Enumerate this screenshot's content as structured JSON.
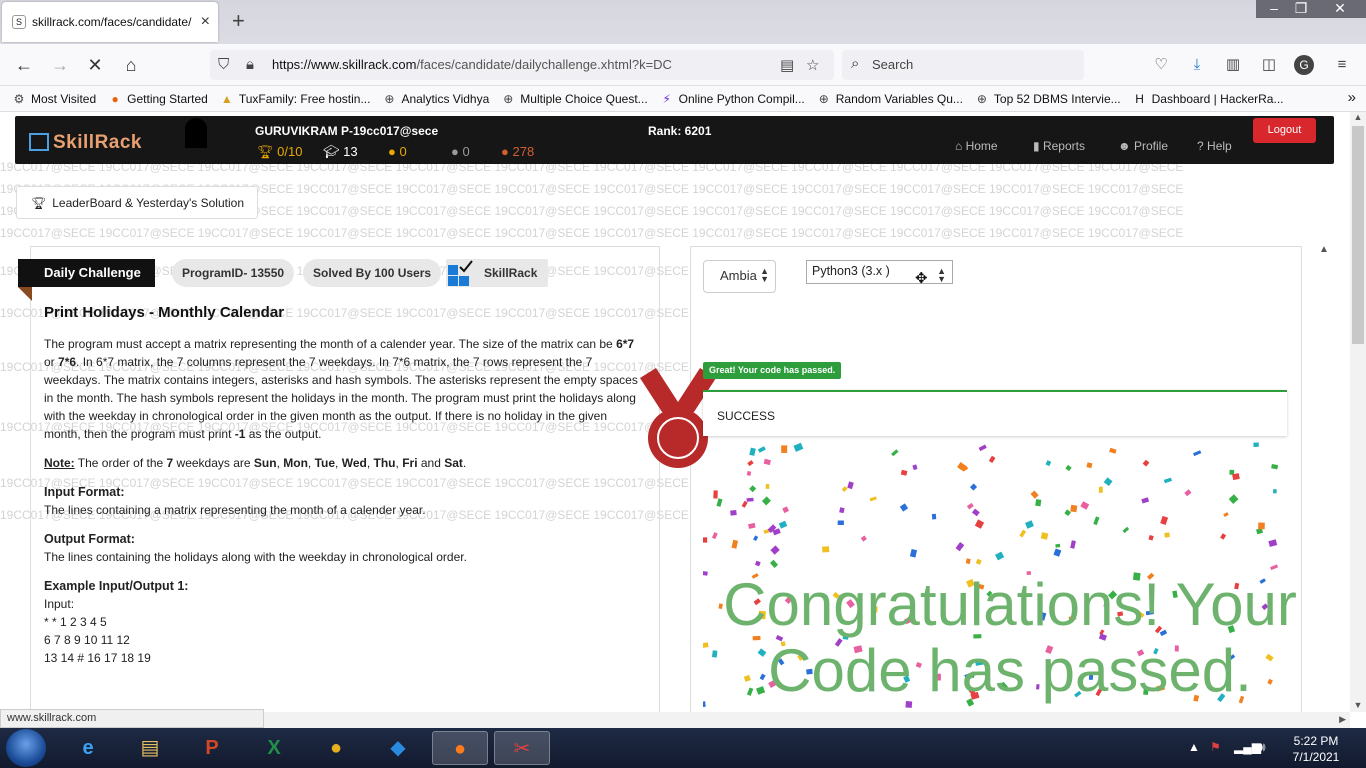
{
  "browser": {
    "tab_title": "skillrack.com/faces/candidate/",
    "url_host": "https://www.skillrack.com",
    "url_path": "/faces/candidate/dailychallenge.xhtml?k=DC",
    "search_placeholder": "Search",
    "bookmarks": [
      {
        "label": "Most Visited",
        "icon": "gear-icon",
        "color": "#444444"
      },
      {
        "label": "Getting Started",
        "icon": "firefox-icon",
        "color": "#e8640c"
      },
      {
        "label": "TuxFamily: Free hostin...",
        "icon": "tux-icon",
        "color": "#d8a020"
      },
      {
        "label": "Analytics Vidhya",
        "icon": "globe-icon",
        "color": "#444444"
      },
      {
        "label": "Multiple Choice Quest...",
        "icon": "globe-icon",
        "color": "#444444"
      },
      {
        "label": "Online Python Compil...",
        "icon": "bolt-icon",
        "color": "#6a2ad8"
      },
      {
        "label": "Random Variables Qu...",
        "icon": "globe-icon",
        "color": "#444444"
      },
      {
        "label": "Top 52 DBMS Intervie...",
        "icon": "globe-icon",
        "color": "#444444"
      },
      {
        "label": "Dashboard | HackerRa...",
        "icon": "hackerrank-icon",
        "color": "#111111"
      }
    ],
    "status_url": "www.skillrack.com"
  },
  "site": {
    "logo": "SkillRack",
    "user": "GURUVIKRAM P-19cc017@sece",
    "rank": "Rank: 6201",
    "stats": [
      {
        "value": "0/10",
        "icon": "trophy-icon",
        "color": "#e8a800"
      },
      {
        "value": "13",
        "icon": "graduation-cap-icon",
        "color": "#ffffff"
      },
      {
        "value": "0",
        "icon": "gold-medal-icon",
        "color": "#e8a800"
      },
      {
        "value": "0",
        "icon": "silver-medal-icon",
        "color": "#9a9a9a"
      },
      {
        "value": "278",
        "icon": "bronze-medal-icon",
        "color": "#d06030"
      }
    ],
    "nav": [
      "Home",
      "Reports",
      "Profile",
      "Help"
    ],
    "logout": "Logout",
    "watermark": "19CC017@SECE 19CC017@SECE 19CC017@SECE 19CC017@SECE 19CC017@SECE 19CC017@SECE 19CC017@SECE 19CC017@SECE 19CC017@SECE 19CC017@SECE 19CC017@SECE 19CC017@SECE"
  },
  "leaderboard_button": "LeaderBoard & Yesterday's Solution",
  "problem": {
    "ribbon": "Daily Challenge",
    "program_id": "ProgramID- 13550",
    "solved_by": "Solved By 100 Users",
    "brand": "SkillRack",
    "title": "Print Holidays - Monthly Calendar",
    "desc_1": "The program must accept a matrix representing the month of a calender year. The size of the matrix can be ",
    "desc_b1": "6*7",
    "desc_2": " or ",
    "desc_b2": "7*6",
    "desc_3": ". In 6*7 matrix, the 7 columns represent the 7 weekdays. In 7*6 matrix, the 7 rows represent the 7 weekdays. The matrix contains integers, asterisks and hash symbols. The asterisks represent the empty spaces in the month. The hash symbols represent the holidays in the month. The program must print the holidays along with the weekday in chronological order in the given month as the output. If there is no holiday in the given month, then the program must print ",
    "desc_b3": "-1",
    "desc_4": " as the output.",
    "note_label": "Note:",
    "note_1": " The order of the ",
    "note_b1": "7",
    "note_2": " weekdays are ",
    "note_days": [
      "Sun",
      "Mon",
      "Tue",
      "Wed",
      "Thu",
      "Fri"
    ],
    "note_and": " and ",
    "note_last": "Sat",
    "note_end": ".",
    "input_format_label": "Input Format:",
    "input_format": "The lines containing a matrix representing the month of a calender year.",
    "output_format_label": "Output Format:",
    "output_format": "The lines containing the holidays along with the weekday in chronological order.",
    "example_label": "Example Input/Output 1:",
    "input_label": "Input:",
    "input_lines": [
      "* * 1 2 3 4 5",
      "6 7 8 9 10 11 12",
      "13 14 # 16 17 18 19"
    ]
  },
  "editor": {
    "theme": "Ambia",
    "language": "Python3 (3.x )",
    "badge": "Great! Your code has passed.",
    "status": "SUCCESS",
    "congrats_line1": "Congratulations! Your",
    "congrats_line2": "Code has passed."
  },
  "taskbar": {
    "apps": [
      {
        "name": "internet-explorer",
        "glyph": "e",
        "color": "#3aa0f0"
      },
      {
        "name": "file-explorer",
        "glyph": "▤",
        "color": "#e8c060"
      },
      {
        "name": "powerpoint",
        "glyph": "P",
        "color": "#d24726"
      },
      {
        "name": "excel",
        "glyph": "X",
        "color": "#1f8f4a"
      },
      {
        "name": "chrome",
        "glyph": "●",
        "color": "#e8b020"
      },
      {
        "name": "vscode",
        "glyph": "◆",
        "color": "#2a8ae0"
      },
      {
        "name": "firefox",
        "glyph": "●",
        "color": "#ff7a1a"
      },
      {
        "name": "snipping-tool",
        "glyph": "✂",
        "color": "#e04040"
      }
    ],
    "time": "5:22 PM",
    "date": "7/1/2021"
  }
}
